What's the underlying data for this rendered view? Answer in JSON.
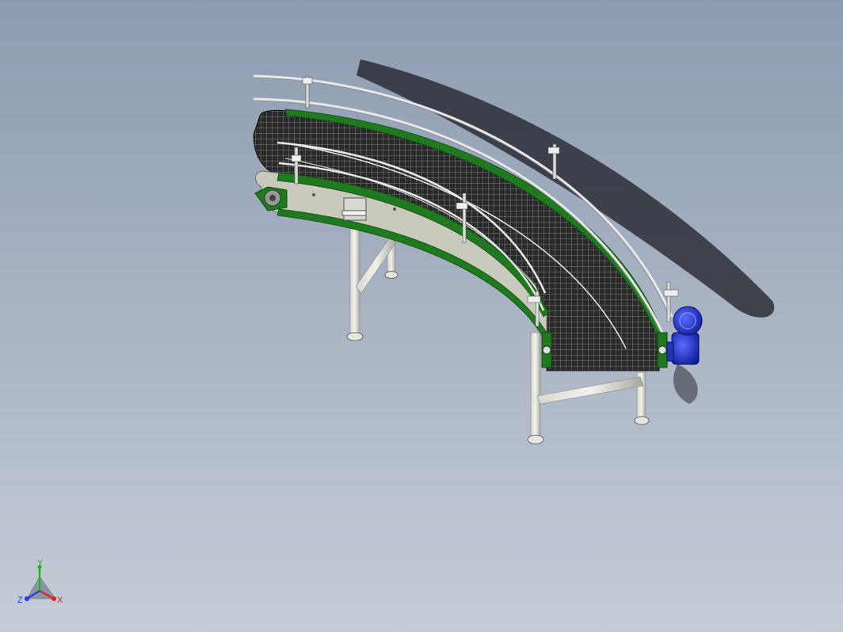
{
  "viewport": {
    "background_top": "#8d9bb1",
    "background_bottom": "#c6ccd7"
  },
  "model": {
    "belt_color": "#1f1f1f",
    "guide_color": "#1f7a1f",
    "frame_color": "#c9c9bd",
    "rail_color": "#e8e8e8",
    "motor_color": "#1a2fc9"
  },
  "triad": {
    "x_label": "X",
    "y_label": "Y",
    "z_label": "Z",
    "x_color": "#e02020",
    "y_color": "#20b020",
    "z_color": "#2040e0"
  }
}
